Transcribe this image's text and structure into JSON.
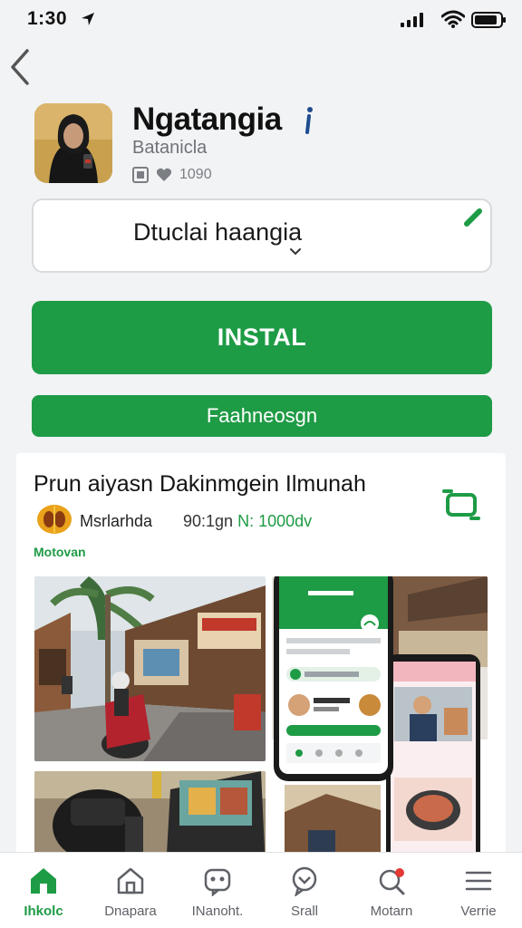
{
  "status_bar": {
    "time": "1:30"
  },
  "app": {
    "title": "Ngatangia",
    "developer": "Batanicla",
    "downloads": "1090"
  },
  "picker": {
    "value": "Dtuclai haangia"
  },
  "install_label": "INSTAL",
  "secondary_label": "Faahneosgn",
  "card": {
    "title": "Prun aiyasn Dakinmgein Ilmunah",
    "seller_name": "Msrlarhda",
    "seller_meta": "90:1gn",
    "seller_meta_accent": "N: 1000dv",
    "section_link": "Motovan"
  },
  "nav": [
    {
      "label": "Ihkolc",
      "icon": "home-icon",
      "active": true
    },
    {
      "label": "Dnapara",
      "icon": "house-outline-icon",
      "active": false
    },
    {
      "label": "INanoht.",
      "icon": "robot-chat-icon",
      "active": false
    },
    {
      "label": "Srall",
      "icon": "chat-bubble-icon",
      "active": false
    },
    {
      "label": "Motarn",
      "icon": "search-notification-icon",
      "active": false
    },
    {
      "label": "Verrie",
      "icon": "menu-icon",
      "active": false
    }
  ],
  "colors": {
    "accent": "#1e9b45",
    "background": "#f2f3f5"
  }
}
